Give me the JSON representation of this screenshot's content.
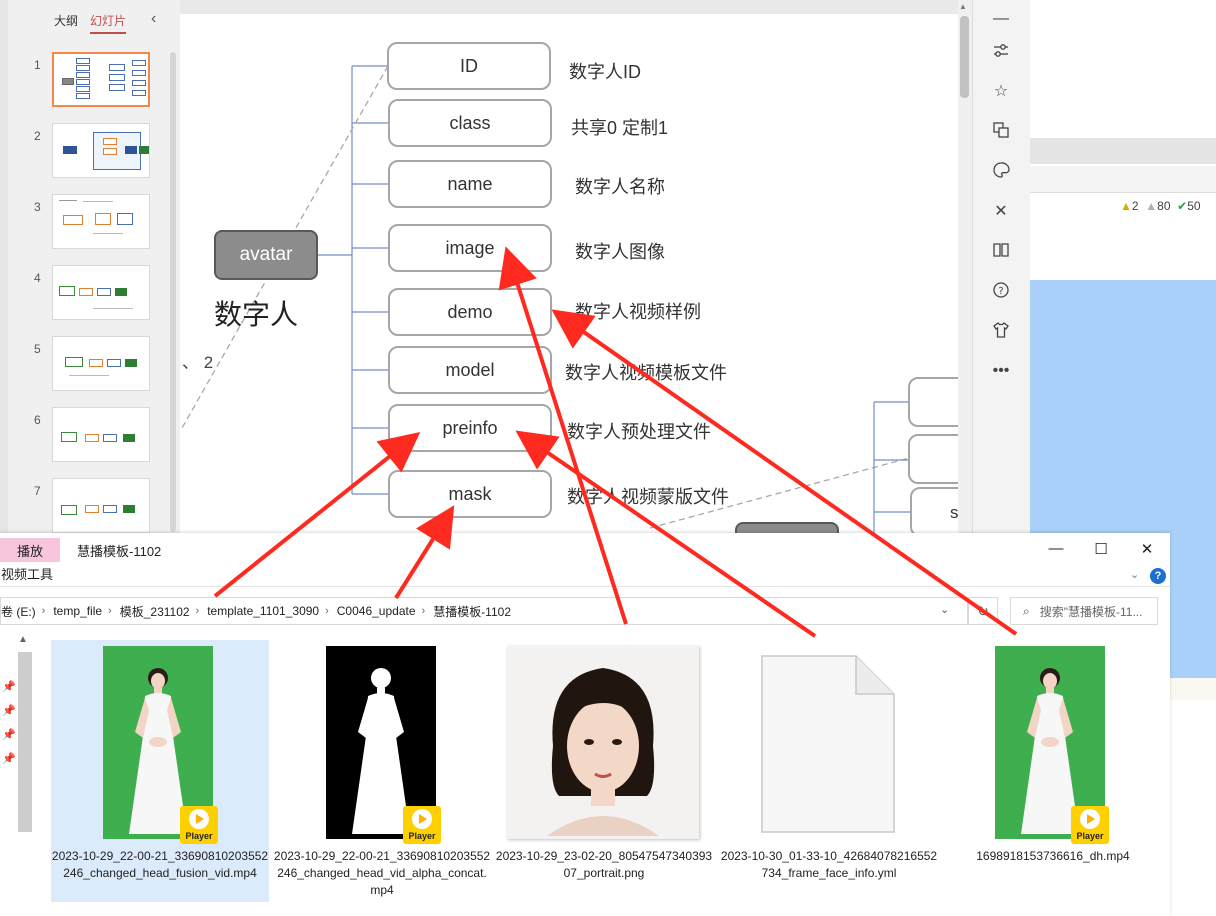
{
  "ppt": {
    "tabs": {
      "outline": "大纲",
      "slides": "幻灯片"
    },
    "slide_numbers": [
      "1",
      "2",
      "3",
      "4",
      "5",
      "6",
      "7"
    ],
    "avatar_node": "avatar",
    "avatar_caption": "数字人",
    "stray_text": "、 2",
    "fields": [
      {
        "key": "ID",
        "desc": "数字人ID"
      },
      {
        "key": "class",
        "desc": "共享0  定制1"
      },
      {
        "key": "name",
        "desc": "数字人名称"
      },
      {
        "key": "image",
        "desc": "数字人图像"
      },
      {
        "key": "demo",
        "desc": "数字人视频样例"
      },
      {
        "key": "model",
        "desc": "数字人视频模板文件"
      },
      {
        "key": "preinfo",
        "desc": "数字人预处理文件"
      },
      {
        "key": "mask",
        "desc": "数字人视频蒙版文件"
      }
    ],
    "partial_node_letter": "s"
  },
  "bg_app": {
    "warn1": "2",
    "warn2": "80",
    "ok": "50"
  },
  "explorer": {
    "context_tab": "播放",
    "ribbon_tool": "视频工具",
    "window_title": "慧播模板-1102",
    "breadcrumb": [
      "卷 (E:)",
      "temp_file",
      "模板_231102",
      "template_1101_3090",
      "C0046_update",
      "慧播模板-1102"
    ],
    "search_placeholder": "搜索\"慧播模板-11...",
    "badge_label": "Player",
    "files": [
      {
        "name": "2023-10-29_22-00-21_33690810203552246_changed_head_fusion_vid.mp4"
      },
      {
        "name": "2023-10-29_22-00-21_33690810203552246_changed_head_vid_alpha_concat.mp4"
      },
      {
        "name": "2023-10-29_23-02-20_8054754734039307_portrait.png"
      },
      {
        "name": "2023-10-30_01-33-10_42684078216552734_frame_face_info.yml"
      },
      {
        "name": "1698918153736616_dh.mp4"
      }
    ]
  },
  "colors": {
    "arrow": "#ff2a1f",
    "tab_accent": "#c0504d",
    "thumb_selected": "#f08a4b",
    "green_screen": "#3fae4f",
    "player_yellow": "#ffd000",
    "explorer_selection": "#dcebfc"
  }
}
